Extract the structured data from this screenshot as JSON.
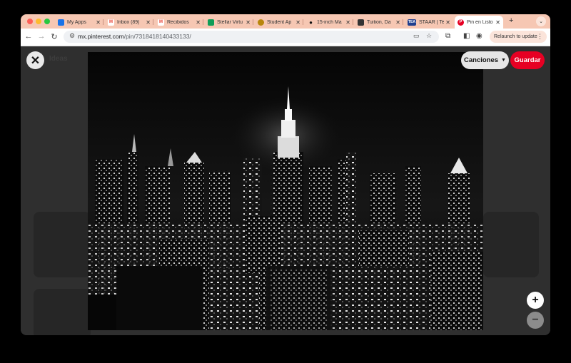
{
  "tabs": [
    {
      "title": "My Apps",
      "favicon": "apps-icon",
      "color": "#1a73e8"
    },
    {
      "title": "Inbox (89)",
      "favicon": "gmail-icon",
      "color": "#ea4335"
    },
    {
      "title": "Recibidos",
      "favicon": "gmail-icon",
      "color": "#ea4335"
    },
    {
      "title": "Stellar Virtu",
      "favicon": "sheets-icon",
      "color": "#0f9d58"
    },
    {
      "title": "Student Ap",
      "favicon": "student-icon",
      "color": "#b8860b"
    },
    {
      "title": "15-inch Ma",
      "favicon": "apple-icon",
      "color": "#111111"
    },
    {
      "title": "Tuition, Da",
      "favicon": "doc-icon",
      "color": "#333333"
    },
    {
      "title": "STAAR | Te",
      "favicon": "tea-icon",
      "color": "#1f3f8f"
    },
    {
      "title": "Pin en Listo",
      "favicon": "pinterest-icon",
      "color": "#e60023"
    }
  ],
  "toolbar": {
    "url_domain": "mx.pinterest.com",
    "url_path": "/pin/731841814043313​3/",
    "relaunch_label": "Relaunch to update"
  },
  "pin": {
    "close_icon": "✕",
    "board_label": "Canciones",
    "save_label": "Guardar",
    "zoom_in": "+",
    "zoom_out": "−",
    "background_hint": "Ideas"
  },
  "colors": {
    "save": "#e60023",
    "tabstrip": "#f6c7b3",
    "overlay": "#2f2f2f"
  }
}
